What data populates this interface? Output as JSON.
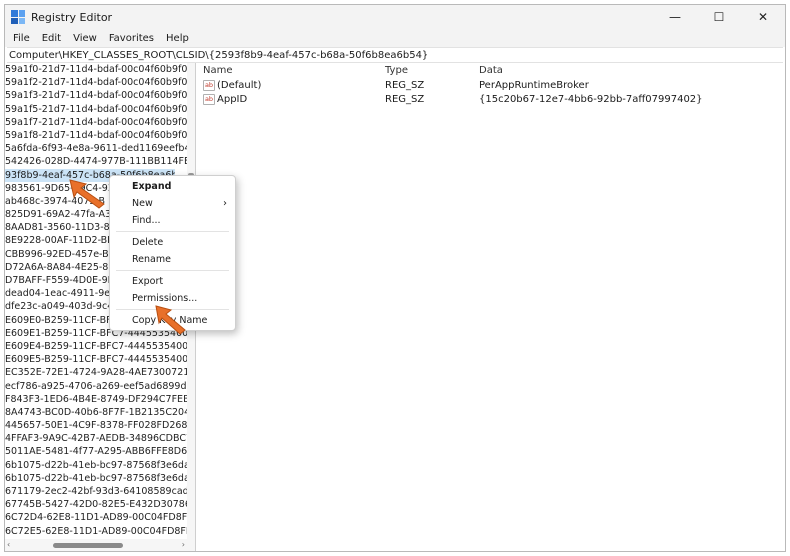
{
  "window": {
    "title": "Registry Editor",
    "controls": {
      "minimize": "—",
      "maximize": "☐",
      "close": "✕"
    }
  },
  "menu": [
    "File",
    "Edit",
    "View",
    "Favorites",
    "Help"
  ],
  "address": "Computer\\HKEY_CLASSES_ROOT\\CLSID\\{2593f8b9-4eaf-457c-b68a-50f6b8ea6b54}",
  "tree": {
    "items": [
      "59a1f0-21d7-11d4-bdaf-00c04f60b9f0}",
      "59a1f2-21d7-11d4-bdaf-00c04f60b9f0}",
      "59a1f3-21d7-11d4-bdaf-00c04f60b9f0}",
      "59a1f5-21d7-11d4-bdaf-00c04f60b9f0}",
      "59a1f7-21d7-11d4-bdaf-00c04f60b9f0}",
      "59a1f8-21d7-11d4-bdaf-00c04f60b9f0}",
      "5a6fda-6f93-4e8a-9611-ded1169eefb4}",
      "542426-028D-4474-977B-111BB114FE3E}",
      "93f8b9-4eaf-457c-b68a-50f6b8ea6b54}",
      "983561-9D65-49C4-9383",
      "ab468c-3974-4075-B",
      "825D91-69A2-47fa-A375",
      "8AAD81-3560-11D3-847",
      "8E9228-00AF-11D2-BF8",
      "CBB996-92ED-457e-B28",
      "D72A6A-8A84-4E25-886",
      "D7BAFF-F559-4D0E-9EA",
      "dead04-1eac-4911-9e3a",
      "dfe23c-a049-403d-9c45",
      "E609E0-B259-11CF-BFC7",
      "E609E1-B259-11CF-BFC7-444553540000}",
      "E609E4-B259-11CF-BFC7-444553540000}",
      "E609E5-B259-11CF-BFC7-444553540000}",
      "EC352E-72E1-4724-9A28-4AE730072149}",
      "ecf786-a925-4706-a269-eef5ad6899db}",
      "F843F3-1ED6-4B4E-8749-DF294C7FEB30}",
      "8A4743-BC0D-40b6-8F7F-1B2135C204D2}",
      "445657-50E1-4C9F-8378-FF028FD26816}",
      "4FFAF3-9A9C-42B7-AEDB-34896CDBC7C1",
      "5011AE-5481-4f77-A295-ABB6FFE8D63E}",
      "6b1075-d22b-41eb-bc97-87568f3e6dab",
      "6b1075-d22b-41eb-bc97-87568f3e6dab}",
      "671179-2ec2-42bf-93d3-64108589cad5}",
      "67745B-5427-42D0-82E5-E432D30786E6}",
      "6C72D4-62E8-11D1-AD89-00C04FD8FDFF",
      "6C72E5-62E8-11D1-AD89-00C04FD8FDFF"
    ]
  },
  "values": {
    "headers": {
      "name": "Name",
      "type": "Type",
      "data": "Data"
    },
    "icon_text": "ab",
    "rows": [
      {
        "name": "(Default)",
        "type": "REG_SZ",
        "data": "PerAppRuntimeBroker"
      },
      {
        "name": "AppID",
        "type": "REG_SZ",
        "data": "{15c20b67-12e7-4bb6-92bb-7aff07997402}"
      }
    ]
  },
  "context_menu": {
    "expand": "Expand",
    "new": "New",
    "find": "Find...",
    "delete": "Delete",
    "rename": "Rename",
    "export": "Export",
    "permissions": "Permissions...",
    "copy_key_name": "Copy Key Name",
    "submenu_arrow": "›"
  },
  "scroll": {
    "left": "‹",
    "right": "›"
  },
  "colors": {
    "selection": "#cce4f7",
    "arrow": "#e8702a",
    "accent": "#2f79d9"
  }
}
